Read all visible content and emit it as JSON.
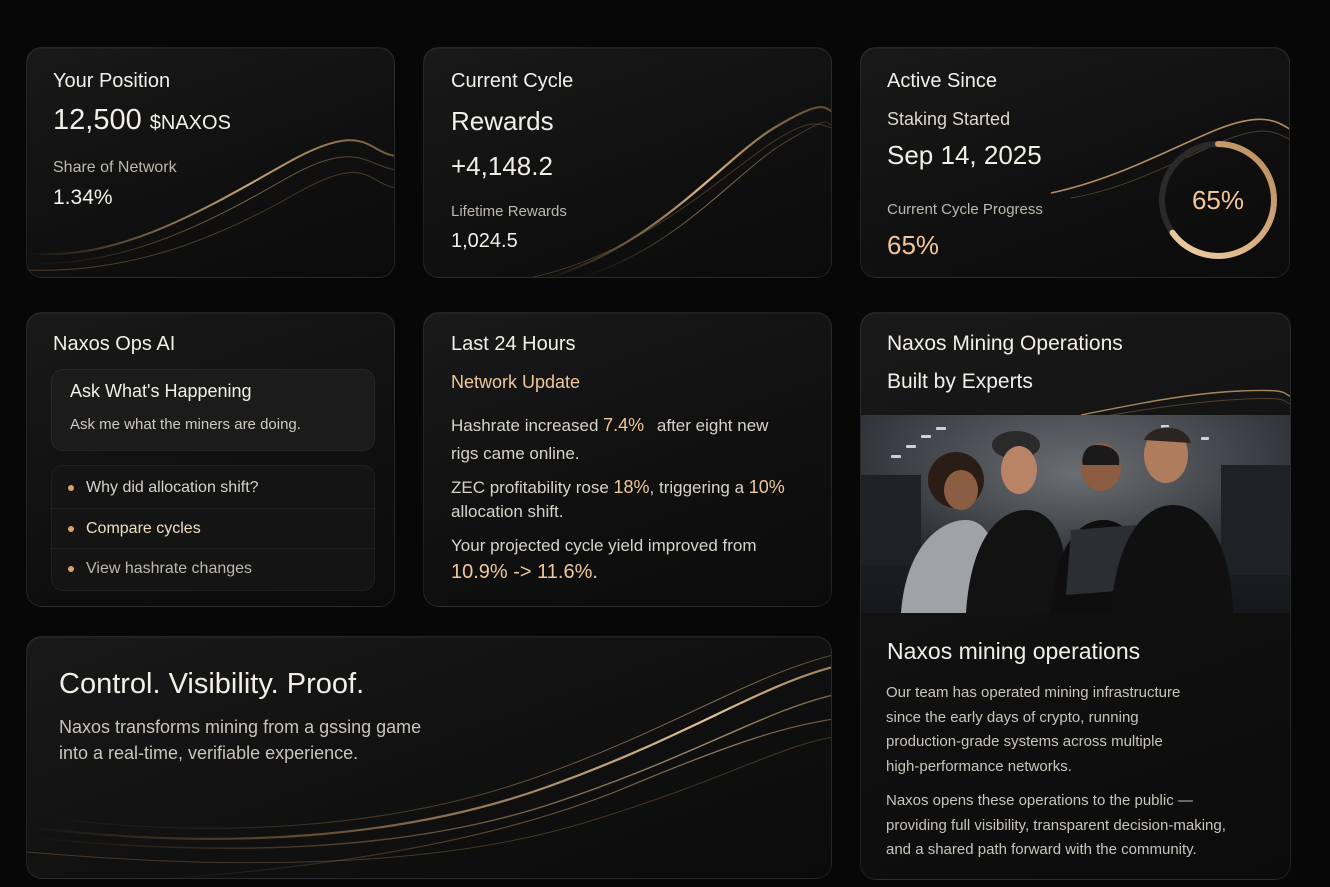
{
  "position": {
    "title": "Your Position",
    "amount": "12,500",
    "token": "$NAXOS",
    "share_label": "Share of Network",
    "share_value": "1.34%"
  },
  "cycle": {
    "title": "Current Cycle",
    "rewards_label": "Rewards",
    "rewards_value": "+4,148.2",
    "lifetime_label": "Lifetime Rewards",
    "lifetime_value": "1,024.5"
  },
  "active": {
    "title": "Active Since",
    "staking_label": "Staking Started",
    "staking_date": "Sep 14, 2025",
    "progress_label": "Current Cycle Progress",
    "progress_value": "65%",
    "ring_label": "65%",
    "progress": 0.65
  },
  "ai": {
    "title": "Naxos Ops AI",
    "ask_title": "Ask What's Happening",
    "ask_prompt": "Ask me what the miners are doing.",
    "suggestions": [
      "Why did allocation shift?",
      "Compare cycles",
      "View hashrate changes"
    ]
  },
  "last24": {
    "title": "Last 24 Hours",
    "subtitle": "Network Update",
    "l1_a": "Hashrate increased ",
    "l1_b": "7.4%",
    "l1_c": "after eight new",
    "l1_d": "rigs came online.",
    "l2_a": "ZEC profitability rose ",
    "l2_b": "18%",
    "l2_c": ", triggering a ",
    "l2_d": "10%",
    "l2_e": "allocation shift.",
    "l3_a": "Your projected cycle yield improved from",
    "l3_b": "10.9% -> 11.6%."
  },
  "ops": {
    "title_1": "Naxos Mining Operations",
    "title_2": "Built by Experts",
    "heading": "Naxos mining operations",
    "p1": [
      "Our team has operated mining infrastructure",
      "since the early days of crypto, running",
      "production-grade systems across multiple",
      "high-performance networks."
    ],
    "p2": [
      "Naxos opens these operations to the public —",
      "providing full visibility, transparent decision-making,",
      "and a shared path forward with the community."
    ]
  },
  "hero": {
    "title": "Control. Visibility. Proof.",
    "line1": "Naxos transforms mining from a gssing game",
    "line2": "into a real-time, verifiable experience."
  },
  "colors": {
    "accent": "#f0c79a",
    "background": "#070707",
    "card": "#141414"
  }
}
